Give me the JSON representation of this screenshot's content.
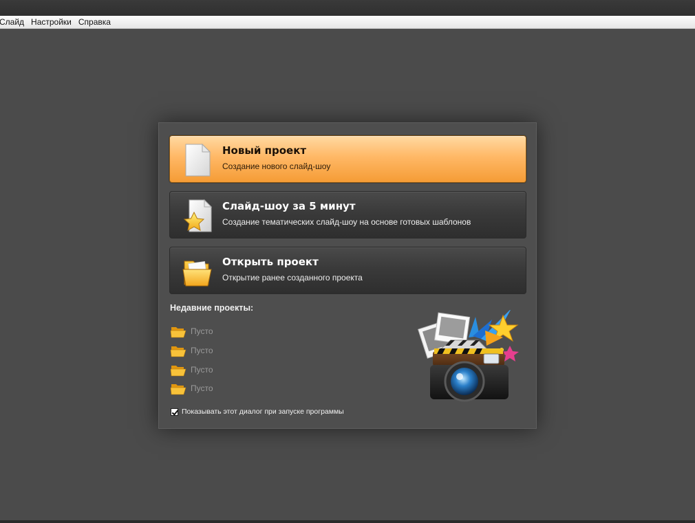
{
  "menu": {
    "items": [
      "Слайд",
      "Настройки",
      "Справка"
    ]
  },
  "dialog": {
    "actions": [
      {
        "title": "Новый проект",
        "subtitle": "Создание нового слайд-шоу",
        "icon": "document-icon"
      },
      {
        "title": "Слайд-шоу за 5 минут",
        "subtitle": "Создание тематических слайд-шоу на основе готовых шаблонов",
        "icon": "star-document-icon"
      },
      {
        "title": "Открыть проект",
        "subtitle": "Открытие ранее созданного проекта",
        "icon": "folder-icon"
      }
    ],
    "recent": {
      "title": "Недавние проекты:",
      "items": [
        "Пусто",
        "Пусто",
        "Пусто",
        "Пусто"
      ]
    },
    "show_on_start": {
      "label": "Показывать этот диалог при запуске программы",
      "checked": true
    }
  },
  "colors": {
    "background": "#4b4b4b",
    "primary_button": "#ffb866",
    "folder": "#f5b324"
  }
}
